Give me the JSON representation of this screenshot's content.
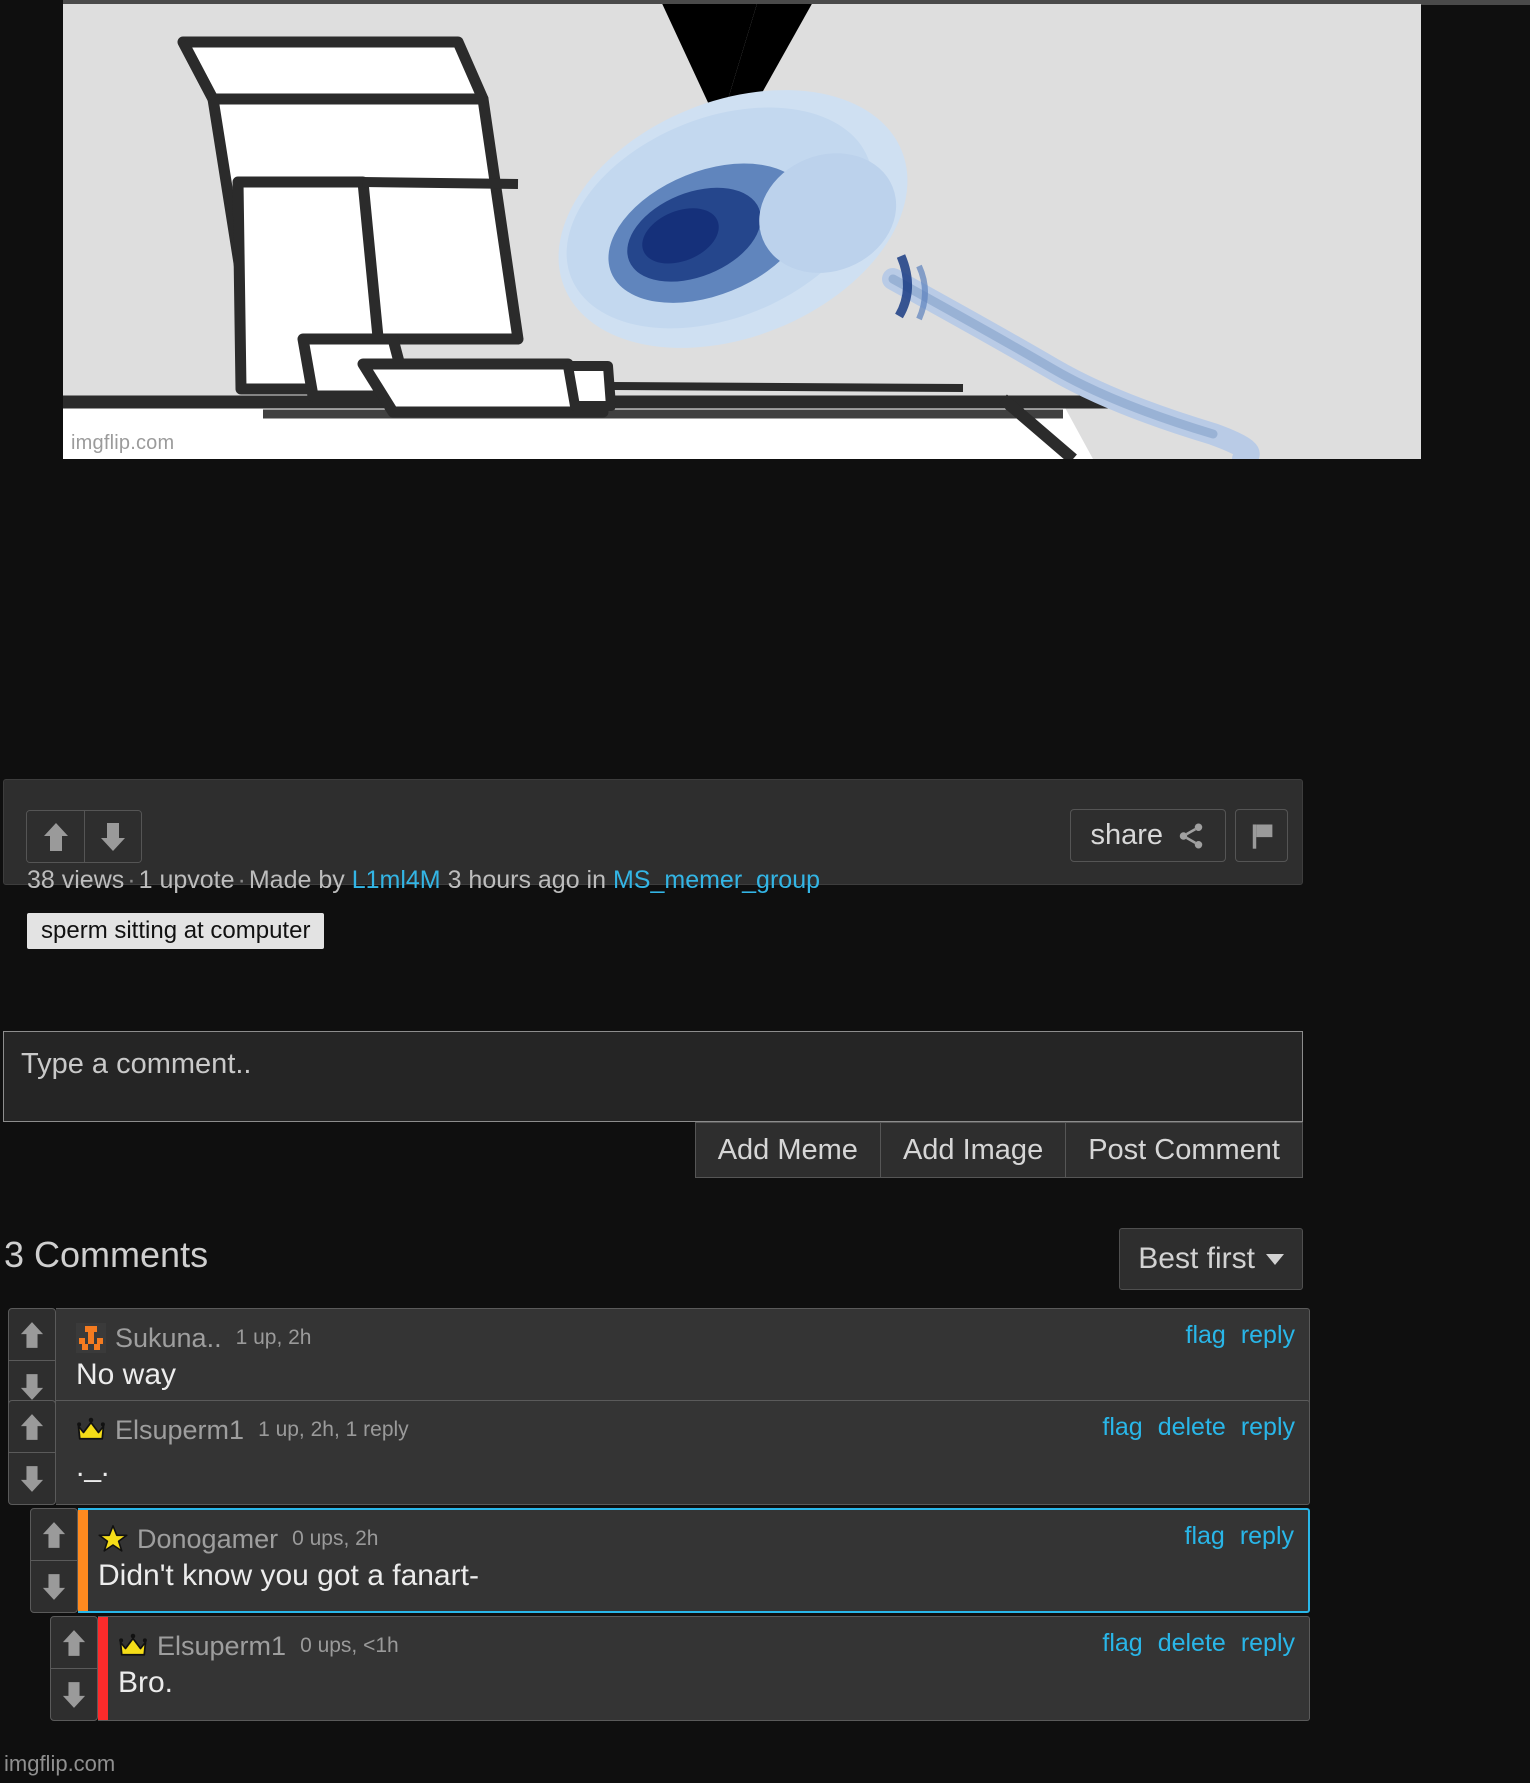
{
  "meme": {
    "watermark": "imgflip.com",
    "alt_description": "sperm sitting at computer meme image"
  },
  "post": {
    "upvote_icon": "arrow-up-icon",
    "downvote_icon": "arrow-down-icon",
    "share_label": "share",
    "share_icon": "share-icon",
    "flag_icon": "flag-icon",
    "views": "38 views",
    "upvotes": "1 upvote",
    "made_by_prefix": "Made by",
    "author": "L1ml4M",
    "time_ago": "3 hours ago in",
    "stream": "MS_memer_group",
    "title": "sperm sitting at computer",
    "separator": "·"
  },
  "composer": {
    "placeholder": "Type a comment..",
    "value": "",
    "add_meme_label": "Add Meme",
    "add_image_label": "Add Image",
    "post_label": "Post Comment"
  },
  "comments_section": {
    "count_label": "3 Comments",
    "sort_label": "Best first",
    "sort_icon": "chevron-down-icon"
  },
  "comments": [
    {
      "user": "Sukuna..",
      "avatar_icon": "pixel-blocks-icon",
      "stats": "1 up, 2h",
      "text": "No way",
      "links": [
        "flag",
        "reply"
      ],
      "indent": 0,
      "stripe_color": "none",
      "highlighted": false
    },
    {
      "user": "Elsuperm1",
      "avatar_icon": "crown-icon",
      "stats": "1 up, 2h, 1 reply",
      "text": "._.",
      "links": [
        "flag",
        "delete",
        "reply"
      ],
      "indent": 0,
      "stripe_color": "none",
      "highlighted": false
    },
    {
      "user": "Donogamer",
      "avatar_icon": "star-icon",
      "stats": "0 ups, 2h",
      "text": "Didn't know you got a fanart-",
      "links": [
        "flag",
        "reply"
      ],
      "indent": 1,
      "stripe_color": "#ff8a1f",
      "highlighted": true
    },
    {
      "user": "Elsuperm1",
      "avatar_icon": "crown-icon",
      "stats": "0 ups, <1h",
      "text": "Bro.",
      "links": [
        "flag",
        "delete",
        "reply"
      ],
      "indent": 2,
      "stripe_color": "#fc2b2b",
      "highlighted": false
    }
  ],
  "footer": {
    "watermark": "imgflip.com"
  },
  "colors": {
    "accent_link": "#33b5e5",
    "highlight_border": "#29b6e8",
    "panel_bg": "#2e2e2e",
    "comment_bg": "#343434",
    "page_bg": "#0f0f0f"
  }
}
